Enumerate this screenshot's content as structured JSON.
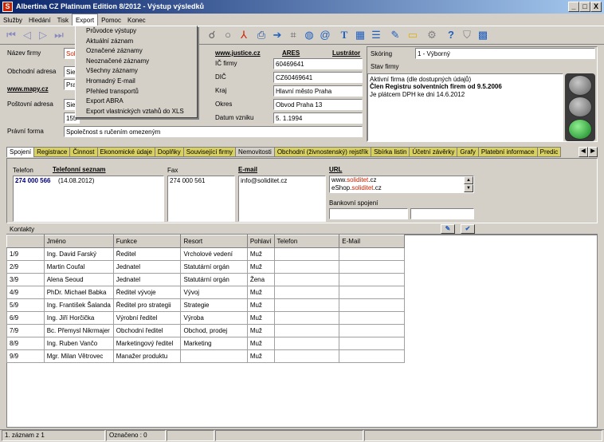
{
  "window": {
    "title": "Albertina CZ Platinum Edition 8/2012 - Výstup výsledků",
    "icon": "S",
    "min": "_",
    "max": "□",
    "close": "X"
  },
  "menu": [
    "Služby",
    "Hledání",
    "Tisk",
    "Export",
    "Pomoc",
    "Konec"
  ],
  "export_menu": [
    "Průvodce výstupy",
    "Aktuální záznam",
    "Označené záznamy",
    "Neoznačené záznamy",
    "Všechny záznamy",
    "Hromadný E-mail",
    "Přehled transportů",
    "Export ABRA",
    "Export vlastnických vztahů do XLS"
  ],
  "form": {
    "nazev_label": "Název firmy",
    "nazev_value": "Solid",
    "adresa_label": "Obchodní adresa",
    "adresa_line1": "Sie",
    "adresa_line2": "Pra",
    "mapy_link": "www.mapy.cz",
    "postovni_label": "Poštovní adresa",
    "postovni_line1": "Sie",
    "postovni_line2": "155",
    "pravni_label": "Právní forma",
    "pravni_value": "Společnost s ručením omezeným",
    "justice_link": "www.justice.cz",
    "ares_link": "ARES",
    "lustrator_link": "Lustrátor",
    "ico_label": "IČ firmy",
    "ico_value": "60469641",
    "dic_label": "DIČ",
    "dic_value": "CZ60469641",
    "kraj_label": "Kraj",
    "kraj_value": "Hlavní město Praha",
    "okres_label": "Okres",
    "okres_value": "Obvod Praha 13",
    "datum_label": "Datum vzniku",
    "datum_value": "5. 1.1994"
  },
  "rating": {
    "label": "Skóring",
    "value": "1 - Výborný",
    "stav_label": "Stav firmy",
    "line1": "Aktivní firma (dle dostupných údajů)",
    "line2": "Člen Registru solventních firem od 9.5.2006",
    "line3": "Je plátcem DPH ke dni 14.6.2012"
  },
  "tabs": [
    "Spojení",
    "Registrace",
    "Činnost",
    "Ekonomické údaje",
    "Doplňky",
    "Související firmy",
    "Nemovitosti",
    "Obchodní (živnostenský) rejstřík",
    "Sbírka listin",
    "Účetní závěrky",
    "Grafy",
    "Platební informace",
    "Predic"
  ],
  "contact": {
    "telefon_label": "Telefon",
    "telefon_seznam": "Telefonní seznam",
    "telefon_value": "274 000 566",
    "telefon_date": "(14.08.2012)",
    "fax_label": "Fax",
    "fax_value": "274 000 561",
    "email_label": "E-mail",
    "email_value": "info@soliditet.cz",
    "url_label": "URL",
    "url1_a": "www.",
    "url1_b": "soliditet",
    ".url1_c": ".cz",
    "url2_a": "eShop.",
    "url2_b": "soliditet",
    "url2_c": ".cz",
    "bank_label": "Bankovní spojení"
  },
  "kontakty_label": "Kontakty",
  "table": {
    "headers": [
      "",
      "Jméno",
      "Funkce",
      "Resort",
      "Pohlaví",
      "Telefon",
      "E-Mail"
    ],
    "rows": [
      [
        "1/9",
        "Ing. David Farský",
        "Ředitel",
        "Vrcholové vedení",
        "Muž",
        "",
        ""
      ],
      [
        "2/9",
        "Martin Coufal",
        "Jednatel",
        "Statutární orgán",
        "Muž",
        "",
        ""
      ],
      [
        "3/9",
        "Alena Seoud",
        "Jednatel",
        "Statutární orgán",
        "Žena",
        "",
        ""
      ],
      [
        "4/9",
        "PhDr. Michael Babka",
        "Ředitel vývoje",
        "Vývoj",
        "Muž",
        "",
        ""
      ],
      [
        "5/9",
        "Ing. František Šalanda",
        "Ředitel pro strategii",
        "Strategie",
        "Muž",
        "",
        ""
      ],
      [
        "6/9",
        "Ing. Jiří Horčička",
        "Výrobní ředitel",
        "Výroba",
        "Muž",
        "",
        ""
      ],
      [
        "7/9",
        "Bc. Přemysl Nikrmajer",
        "Obchodní ředitel",
        "Obchod, prodej",
        "Muž",
        "",
        ""
      ],
      [
        "8/9",
        "Ing. Ruben Vančo",
        "Marketingový ředitel",
        "Marketing",
        "Muž",
        "",
        ""
      ],
      [
        "9/9",
        "Mgr. Milan Větrovec",
        "Manažer produktu",
        "",
        "Muž",
        "",
        ""
      ]
    ]
  },
  "status": {
    "left": "1. záznam z 1",
    "mid": "Označeno : 0"
  },
  "colors": {
    "title_start": "#0a246a",
    "title_end": "#a6caf0",
    "accent_red": "#cc2200",
    "link_blue": "#000080"
  }
}
